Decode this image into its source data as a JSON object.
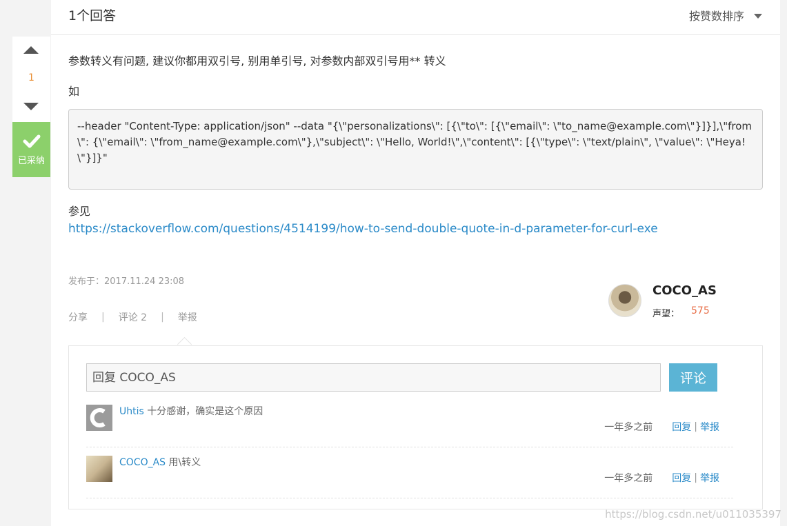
{
  "header": {
    "answer_count": "1个回答",
    "sort_label": "按赞数排序"
  },
  "vote": {
    "count": "1",
    "accepted_label": "已采纳",
    "accepted_color": "#8cd06b"
  },
  "answer": {
    "para1": "参数转义有问题, 建议你都用双引号, 别用单引号, 对参数内部双引号用** 转义",
    "para2": "如",
    "code": "--header \"Content-Type: application/json\" --data \"{\\\"personalizations\\\": [{\\\"to\\\": [{\\\"email\\\": \\\"to_name@example.com\\\"}]}],\\\"from\\\": {\\\"email\\\": \\\"from_name@example.com\\\"},\\\"subject\\\": \\\"Hello, World!\\\",\\\"content\\\": [{\\\"type\\\": \\\"text/plain\\\", \\\"value\\\": \\\"Heya!\\\"}]}\"",
    "see_also": "参见",
    "link": "https://stackoverflow.com/questions/4514199/how-to-send-double-quote-in-d-parameter-for-curl-exe",
    "published": "发布于：2017.11.24 23:08",
    "actions": {
      "share": "分享",
      "comment": "评论 2",
      "report": "举报"
    }
  },
  "author": {
    "name": "COCO_AS",
    "rep_label": "声望：",
    "rep_value": "575"
  },
  "comment_form": {
    "placeholder": "回复 COCO_AS",
    "submit": "评论"
  },
  "comments": [
    {
      "user": "Uhtis",
      "text": " 十分感谢，确实是这个原因",
      "time": "一年多之前",
      "reply": "回复",
      "report": "举报"
    },
    {
      "user": "COCO_AS",
      "text": " 用\\转义",
      "time": "一年多之前",
      "reply": "回复",
      "report": "举报"
    }
  ],
  "watermark": "https://blog.csdn.net/u011035397",
  "colors": {
    "link": "#2a8ac8",
    "reputation": "#e8704a",
    "submit": "#5bb4d5",
    "vote_count": "#e98f36"
  }
}
